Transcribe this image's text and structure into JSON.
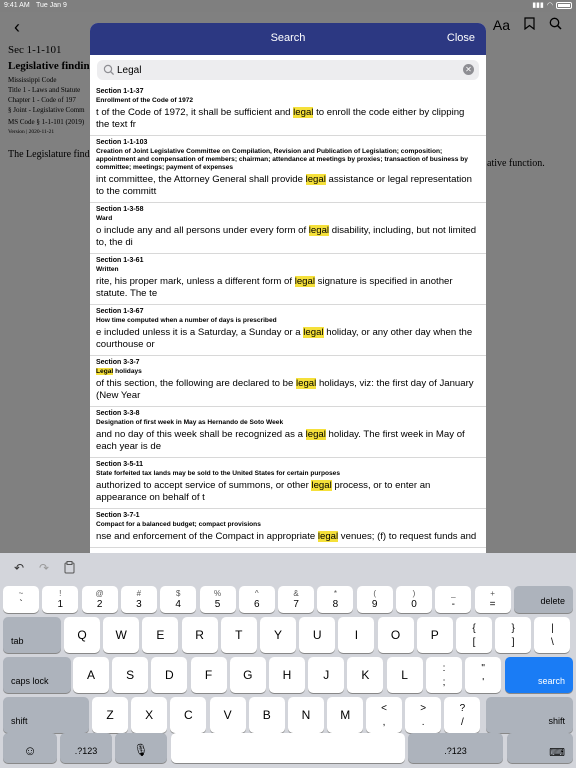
{
  "status": {
    "time": "9:41 AM",
    "date": "Tue Jan 9"
  },
  "background": {
    "section": "Sec 1-1-101",
    "title": "Legislative finding",
    "meta": [
      "Mississippi Code",
      "Title 1 - Laws and Statute",
      "Chapter 1 - Code of 197",
      "§ Joint - Legislative Comm"
    ],
    "ms_code": "MS Code § 1-1-101 (2019)",
    "version": "Version | 2020-11-21",
    "body_left": "The Legislature find",
    "body_right": "ative function.",
    "icons": [
      "back-chevron-icon",
      "font-size-icon",
      "bookmark-icon",
      "search-icon"
    ],
    "font_label": "Aa"
  },
  "modal": {
    "title": "Search",
    "close_label": "Close",
    "search_value": "Legal",
    "results": [
      {
        "section": "Section 1-1-37",
        "heading": "Enrollment of the Code of 1972",
        "before": "t of the Code of 1972, it shall be sufficient and ",
        "match": "legal",
        "after": " to enroll the code either by clipping the text fr"
      },
      {
        "section": "Section 1-1-103",
        "heading": "Creation of Joint Legislative Committee on Compilation, Revision and Publication of Legislation; composition; appointment and compensation of members; chairman; attendance at meetings by proxies; transaction of business by committee; meetings; payment of expenses",
        "before": "int committee, the Attorney General shall provide ",
        "match": "legal",
        "after": " assistance or legal representation to the committ"
      },
      {
        "section": "Section 1-3-58",
        "heading": "Ward",
        "before": "o include any and all persons under every form of ",
        "match": "legal",
        "after": " disability, including, but not limited to, the di"
      },
      {
        "section": "Section 1-3-61",
        "heading": "Written",
        "before": "rite, his proper mark, unless a different form of ",
        "match": "legal",
        "after": " signature is specified in another statute. The te"
      },
      {
        "section": "Section 1-3-67",
        "heading": "How time computed when a number of days is prescribed",
        "before": "e included unless it is a Saturday, a Sunday or a ",
        "match": "legal",
        "after": " holiday, or any other day when the courthouse or"
      },
      {
        "section": "Section 3-3-7",
        "heading_match": "Legal",
        "heading_rest": " holidays",
        "before": "of this section, the following are declared to be ",
        "match": "legal",
        "after": " holidays, viz: the first day of January (New Year"
      },
      {
        "section": "Section 3-3-8",
        "heading": "Designation of first week in May as Hernando de Soto Week",
        "before": " and no day of this week shall be recognized as a ",
        "match": "legal",
        "after": " holiday. The first week in May of each year is de"
      },
      {
        "section": "Section 3-5-11",
        "heading": "State forfeited tax lands may be sold to the United States for certain purposes",
        "before": "authorized to accept service of summons, or other ",
        "match": "legal",
        "after": " process, or to enter an appearance on behalf of t"
      },
      {
        "section": "Section 3-7-1",
        "heading": "Compact for a balanced budget; compact provisions",
        "before": "nse and enforcement of the Compact in appropriate ",
        "match": "legal",
        "after": " venues; (f) to request funds and"
      }
    ]
  },
  "keyboard": {
    "toolbar": [
      "undo-icon",
      "redo-icon",
      "paste-icon"
    ],
    "row1": [
      {
        "alt": "~",
        "main": "`"
      },
      {
        "alt": "!",
        "main": "1"
      },
      {
        "alt": "@",
        "main": "2"
      },
      {
        "alt": "#",
        "main": "3"
      },
      {
        "alt": "$",
        "main": "4"
      },
      {
        "alt": "%",
        "main": "5"
      },
      {
        "alt": "^",
        "main": "6"
      },
      {
        "alt": "&",
        "main": "7"
      },
      {
        "alt": "*",
        "main": "8"
      },
      {
        "alt": "(",
        "main": "9"
      },
      {
        "alt": ")",
        "main": "0"
      },
      {
        "alt": "_",
        "main": "-"
      },
      {
        "alt": "+",
        "main": "="
      }
    ],
    "delete": "delete",
    "tab": "tab",
    "row2": [
      "Q",
      "W",
      "E",
      "R",
      "T",
      "Y",
      "U",
      "I",
      "O",
      "P"
    ],
    "row2_extra": [
      {
        "alt": "{",
        "main": "["
      },
      {
        "alt": "}",
        "main": "]"
      },
      {
        "alt": "|",
        "main": "\\"
      }
    ],
    "caps": "caps lock",
    "row3": [
      "A",
      "S",
      "D",
      "F",
      "G",
      "H",
      "J",
      "K",
      "L"
    ],
    "row3_extra": [
      {
        "alt": ":",
        "main": ";"
      },
      {
        "alt": "\"",
        "main": "'"
      }
    ],
    "search": "search",
    "shift": "shift",
    "row4": [
      "Z",
      "X",
      "C",
      "V",
      "B",
      "N",
      "M"
    ],
    "row4_extra": [
      {
        "alt": "<",
        "main": ","
      },
      {
        "alt": ">",
        "main": "."
      },
      {
        "alt": "?",
        "main": "/"
      }
    ],
    "numbers": ".?123",
    "emoji": "☺",
    "mic": "mic-icon",
    "hide": "keyboard-hide-icon"
  }
}
